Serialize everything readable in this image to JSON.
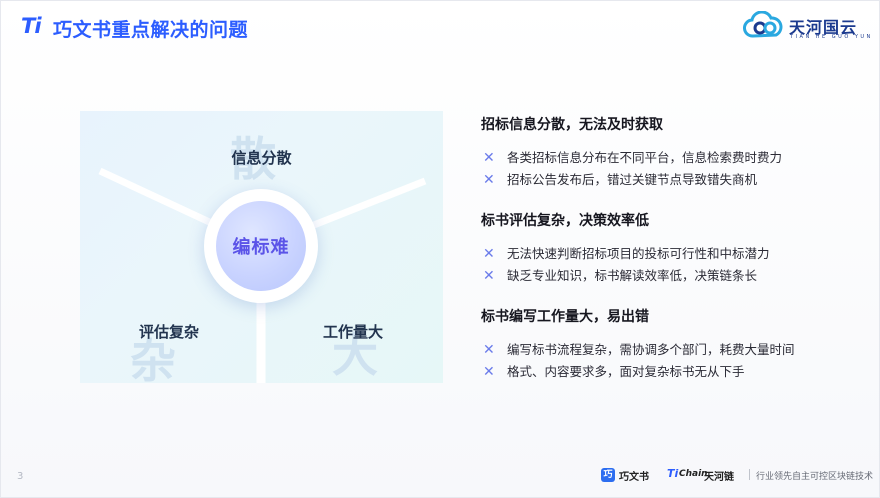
{
  "header": {
    "logo_mark": "Ti",
    "title": "巧文书重点解决的问题",
    "brand_name": "天河国云",
    "brand_pinyin": "TIAN HE GUO YUN",
    "brand_icon": "cloud-logo-icon"
  },
  "diagram": {
    "center": "编标难",
    "top": {
      "label": "信息分散",
      "ghost": "散"
    },
    "left": {
      "label": "评估复杂",
      "ghost": "杂"
    },
    "right": {
      "label": "工作量大",
      "ghost": "大"
    }
  },
  "sections": [
    {
      "title": "招标信息分散，无法及时获取",
      "items": [
        "各类招标信息分布在不同平台，信息检索费时费力",
        "招标公告发布后，错过关键节点导致错失商机"
      ]
    },
    {
      "title": "标书评估复杂，决策效率低",
      "items": [
        "无法快速判断招标项目的投标可行性和中标潜力",
        "缺乏专业知识，标书解读效率低，决策链条长"
      ]
    },
    {
      "title": "标书编写工作量大，易出错",
      "items": [
        "编写标书流程复杂，需协调多个部门，耗费大量时间",
        "格式、内容要求多，面对复杂标书无从下手"
      ]
    }
  ],
  "footer": {
    "page_number": "3",
    "product1": "巧文书",
    "product2_ti": "Ti",
    "product2_chain": "Chain",
    "product2_name": "天河链",
    "slogan": "行业领先自主可控区块链技术"
  },
  "colors": {
    "accent": "#2c5dff",
    "center_text": "#5b54e8",
    "x_icon": "#6a7bea"
  }
}
